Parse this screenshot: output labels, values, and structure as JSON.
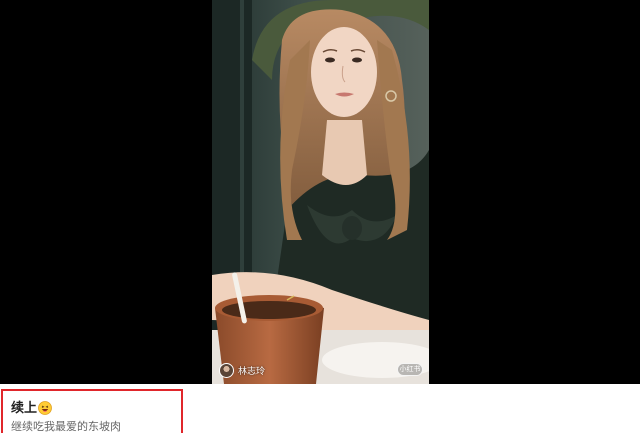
{
  "video": {
    "author_name": "林志玲",
    "platform_badge": "小红书"
  },
  "post": {
    "title": "续上",
    "title_emoji": "laughing-face-emoji",
    "body": "继续吃我最爱的东坡肉"
  },
  "colors": {
    "highlight_border": "#e0262b",
    "stage_background": "#000000"
  }
}
